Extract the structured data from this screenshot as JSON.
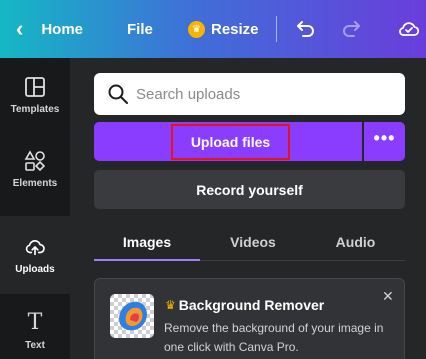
{
  "topbar": {
    "home_label": "Home",
    "file_label": "File",
    "resize_label": "Resize",
    "icons": [
      "chevron-left-icon",
      "crown-icon",
      "undo-icon",
      "redo-icon",
      "cloud-check-icon"
    ]
  },
  "sidebar": {
    "items": [
      {
        "label": "Templates",
        "icon": "templates-icon"
      },
      {
        "label": "Elements",
        "icon": "elements-icon"
      },
      {
        "label": "Uploads",
        "icon": "upload-cloud-icon",
        "active": true
      },
      {
        "label": "Text",
        "icon": "text-icon"
      }
    ]
  },
  "search": {
    "placeholder": "Search uploads"
  },
  "upload": {
    "label": "Upload files",
    "more_label": "•••"
  },
  "record": {
    "label": "Record yourself"
  },
  "tabs": [
    {
      "label": "Images",
      "active": true
    },
    {
      "label": "Videos"
    },
    {
      "label": "Audio"
    }
  ],
  "promo": {
    "title": "Background Remover",
    "description": "Remove the background of your image in one click with Canva Pro.",
    "close_label": "✕"
  },
  "colors": {
    "accent": "#8b3dff",
    "highlight_border": "#e8121a",
    "crown": "#f7b500",
    "panel_bg": "#252627",
    "rail_bg": "#18191b"
  }
}
